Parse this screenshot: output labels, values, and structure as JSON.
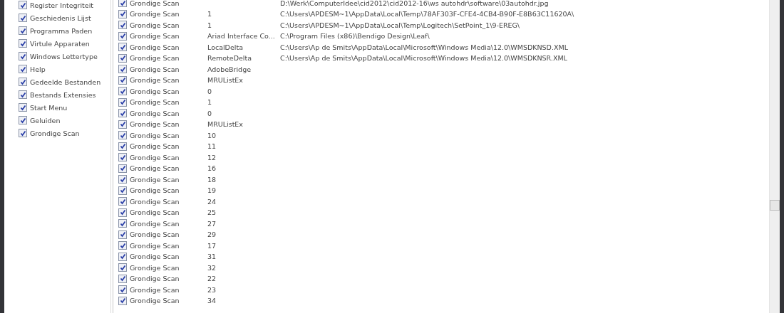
{
  "categories": [
    {
      "label": "Register Integriteit",
      "checked": true
    },
    {
      "label": "Geschiedenis Lijst",
      "checked": true
    },
    {
      "label": "Programma Paden",
      "checked": true
    },
    {
      "label": "Virtule Apparaten",
      "checked": true
    },
    {
      "label": "Windows Lettertype",
      "checked": true
    },
    {
      "label": "Help",
      "checked": true
    },
    {
      "label": "Gedeelde Bestanden",
      "checked": true
    },
    {
      "label": "Bestands Extensies",
      "checked": true
    },
    {
      "label": "Start Menu",
      "checked": true
    },
    {
      "label": "Geluiden",
      "checked": true
    },
    {
      "label": "Grondige Scan",
      "checked": true
    }
  ],
  "results": [
    {
      "section": "Grondige Scan",
      "checked": true,
      "path": "D:\\Werk\\ComputerIdee\\cid2012\\cid2012-16\\ws autohdr\\software\\03autohdr.jpg"
    },
    {
      "section": "Grondige Scan",
      "checked": true,
      "value": "1",
      "path": "C:\\Users\\APDESM~1\\AppData\\Local\\Temp\\78AF303F-CFE4-4CB4-B90F-E8B63C11620A\\"
    },
    {
      "section": "Grondige Scan",
      "checked": true,
      "value": "1",
      "path": "C:\\Users\\APDESM~1\\AppData\\Local\\Temp\\Logitech\\SetPoint_1\\9-EREG\\"
    },
    {
      "section": "Grondige Scan",
      "checked": true,
      "value": "Ariad Interface Co...",
      "path": "C:\\Program Files (x86)\\Bendigo Design\\Leaf\\"
    },
    {
      "section": "Grondige Scan",
      "checked": true,
      "value": "LocalDelta",
      "path": "C:\\Users\\Ap de Smits\\AppData\\Local\\Microsoft\\Windows Media\\12.0\\WMSDKNSD.XML"
    },
    {
      "section": "Grondige Scan",
      "checked": true,
      "value": "RemoteDelta",
      "path": "C:\\Users\\Ap de Smits\\AppData\\Local\\Microsoft\\Windows Media\\12.0\\WMSDKNSR.XML"
    },
    {
      "section": "Grondige Scan",
      "checked": true,
      "value": "AdobeBridge"
    },
    {
      "section": "Grondige Scan",
      "checked": true,
      "value": "MRUListEx"
    },
    {
      "section": "Grondige Scan",
      "checked": true,
      "value": "0"
    },
    {
      "section": "Grondige Scan",
      "checked": true,
      "value": "1"
    },
    {
      "section": "Grondige Scan",
      "checked": true,
      "value": "0"
    },
    {
      "section": "Grondige Scan",
      "checked": true,
      "value": "MRUListEx"
    },
    {
      "section": "Grondige Scan",
      "checked": true,
      "value": "10"
    },
    {
      "section": "Grondige Scan",
      "checked": true,
      "value": "11"
    },
    {
      "section": "Grondige Scan",
      "checked": true,
      "value": "12"
    },
    {
      "section": "Grondige Scan",
      "checked": true,
      "value": "16"
    },
    {
      "section": "Grondige Scan",
      "checked": true,
      "value": "18"
    },
    {
      "section": "Grondige Scan",
      "checked": true,
      "value": "19"
    },
    {
      "section": "Grondige Scan",
      "checked": true,
      "value": "24"
    },
    {
      "section": "Grondige Scan",
      "checked": true,
      "value": "25"
    },
    {
      "section": "Grondige Scan",
      "checked": true,
      "value": "27"
    },
    {
      "section": "Grondige Scan",
      "checked": true,
      "value": "29"
    },
    {
      "section": "Grondige Scan",
      "checked": true,
      "value": "17"
    },
    {
      "section": "Grondige Scan",
      "checked": true,
      "value": "31"
    },
    {
      "section": "Grondige Scan",
      "checked": true,
      "value": "32"
    },
    {
      "section": "Grondige Scan",
      "checked": true,
      "value": "22"
    },
    {
      "section": "Grondige Scan",
      "checked": true,
      "value": "23"
    },
    {
      "section": "Grondige Scan",
      "checked": true,
      "value": "34"
    }
  ]
}
